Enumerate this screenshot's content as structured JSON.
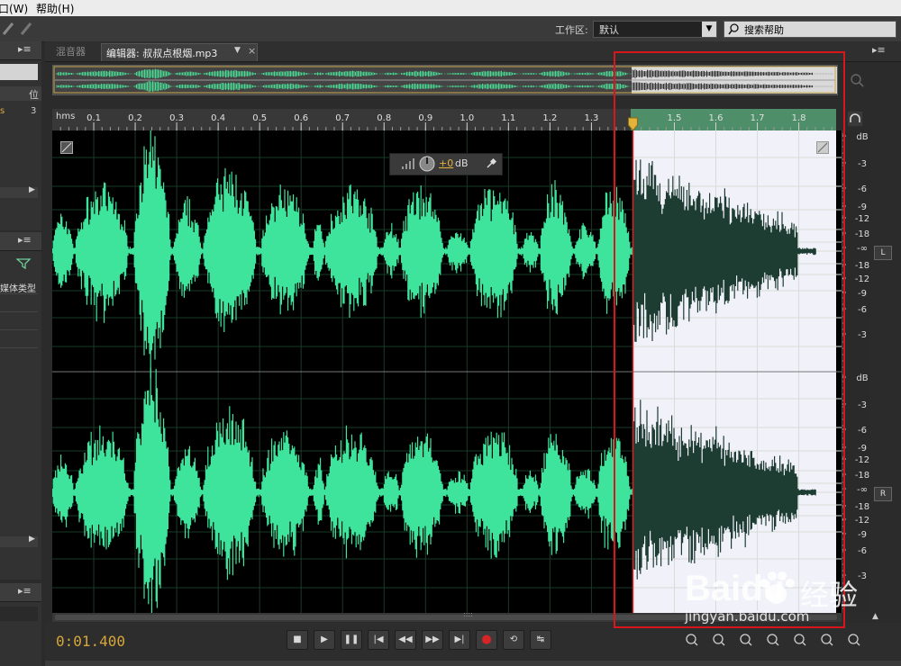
{
  "menu": {
    "window_fragment": "口(W)",
    "help": "帮助(H)"
  },
  "toolbar": {
    "workspace_label": "工作区:",
    "workspace_value": "默认",
    "search_help": "搜索帮助"
  },
  "left_panel": {
    "col_header": "位",
    "value_row": "s",
    "value_num": "3",
    "media_type": "媒体类型"
  },
  "tabs": [
    {
      "label": "混音器"
    },
    {
      "label": "编辑器: 叔叔点根烟.mp3"
    }
  ],
  "ruler": {
    "unit": "hms",
    "ticks": [
      "0.1",
      "0.2",
      "0.3",
      "0.4",
      "0.5",
      "0.6",
      "0.7",
      "0.8",
      "0.9",
      "1.0",
      "1.1",
      "1.2",
      "1.3",
      "1.5",
      "1.6",
      "1.7",
      "1.8"
    ],
    "tick_values": [
      0.1,
      0.2,
      0.3,
      0.4,
      0.5,
      0.6,
      0.7,
      0.8,
      0.9,
      1.0,
      1.1,
      1.2,
      1.3,
      1.5,
      1.6,
      1.7,
      1.8
    ],
    "view_range_s": [
      0.0,
      1.89
    ],
    "playhead_s": 1.4,
    "selection_s": [
      1.4,
      1.89
    ]
  },
  "volume_hud": {
    "value": "+0",
    "unit": "dB"
  },
  "db_scale": {
    "top_channel": [
      "dB",
      "-3",
      "-6",
      "-9",
      "-12",
      "-18",
      "-∞",
      "-18",
      "-12",
      "-9",
      "-6",
      "-3"
    ],
    "bottom_channel": [
      "dB",
      "-3",
      "-6",
      "-9",
      "-12",
      "-18",
      "-∞",
      "-18",
      "-12",
      "-9",
      "-6",
      "-3"
    ]
  },
  "channels": {
    "left": "L",
    "right": "R"
  },
  "transport": {
    "time": "0:01.400",
    "buttons": [
      "stop",
      "play",
      "pause",
      "to-start",
      "rewind",
      "fast-forward",
      "to-end",
      "record",
      "loop",
      "skip-selection"
    ]
  },
  "watermark": {
    "brand": "Baidu",
    "brand_cn": "经验",
    "url": "jingyan.baidu.com"
  },
  "colors": {
    "waveform": "#3fe49c",
    "selected_wave": "#1d3d33",
    "selection_bg": "#f1f1f9",
    "accent_time": "#d6a63a",
    "highlight_box": "#d8161c"
  }
}
